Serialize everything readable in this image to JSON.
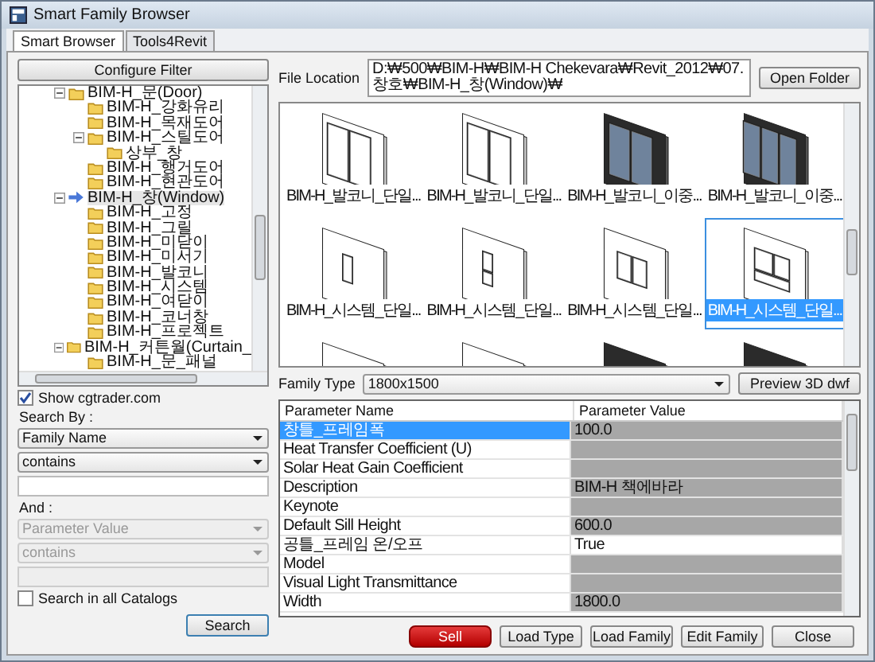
{
  "window": {
    "title": "Smart Family Browser"
  },
  "tabs": [
    {
      "label": "Smart Browser",
      "selected": true
    },
    {
      "label": "Tools4Revit",
      "selected": false
    }
  ],
  "filter": {
    "configure_button": "Configure Filter",
    "tree": [
      {
        "label": "BIM-H_문(Door)",
        "selected": false,
        "expanded": true,
        "children": [
          {
            "label": "BIM-H_강화유리",
            "selected": false
          },
          {
            "label": "BIM-H_목재도어",
            "selected": false
          },
          {
            "label": "BIM-H_스틸도어",
            "selected": false,
            "expanded": true,
            "children": [
              {
                "label": "상부_창",
                "selected": false
              }
            ]
          },
          {
            "label": "BIM-H_행거도어",
            "selected": false
          },
          {
            "label": "BIM-H_현관도어",
            "selected": false
          }
        ]
      },
      {
        "label": "BIM-H_창(Window)",
        "selected": true,
        "expanded": true,
        "children": [
          {
            "label": "BIM-H_고정",
            "selected": false
          },
          {
            "label": "BIM-H_그릴",
            "selected": false
          },
          {
            "label": "BIM-H_미닫이",
            "selected": false
          },
          {
            "label": "BIM-H_미서기",
            "selected": false
          },
          {
            "label": "BIM-H_발코니",
            "selected": false
          },
          {
            "label": "BIM-H_시스템",
            "selected": false
          },
          {
            "label": "BIM-H_여닫이",
            "selected": false
          },
          {
            "label": "BIM-H_코너창",
            "selected": false
          },
          {
            "label": "BIM-H_프로젝트",
            "selected": false
          }
        ]
      },
      {
        "label": "BIM-H_커튼월(Curtain_",
        "selected": false,
        "expanded": true,
        "children": [
          {
            "label": "BIM-H_문_패널",
            "selected": false
          }
        ]
      }
    ],
    "show_cgtrader": {
      "label": "Show cgtrader.com",
      "checked": true
    },
    "search_by_label": "Search By :",
    "search_field": {
      "value": "Family Name"
    },
    "operator": {
      "value": "contains"
    },
    "and_label": "And :",
    "param_field": {
      "value": "Parameter Value",
      "disabled": true
    },
    "param_operator": {
      "value": "contains",
      "disabled": true
    },
    "search_all": {
      "label": "Search in all Catalogs",
      "checked": false
    },
    "search_button": "Search"
  },
  "file_location": {
    "label": "File Location",
    "value": "D:₩500₩BIM-H₩BIM-H Chekevara₩Revit_2012₩07. 창호₩BIM-H_창(Window)₩",
    "button": "Open Folder"
  },
  "thumbnails": [
    {
      "label": "BIM-H_발코니_단일...",
      "kind": "double",
      "selected": false
    },
    {
      "label": "BIM-H_발코니_단일...",
      "kind": "double",
      "selected": false
    },
    {
      "label": "BIM-H_발코니_이중...",
      "kind": "darkdouble",
      "selected": false
    },
    {
      "label": "BIM-H_발코니_이중...",
      "kind": "darktriple",
      "selected": false
    },
    {
      "label": "BIM-H_시스템_단일...",
      "kind": "narrow",
      "selected": false
    },
    {
      "label": "BIM-H_시스템_단일...",
      "kind": "split",
      "selected": false
    },
    {
      "label": "BIM-H_시스템_단일...",
      "kind": "pair",
      "selected": false
    },
    {
      "label": "BIM-H_시스템_단일...",
      "kind": "grid",
      "selected": true
    },
    {
      "kind": "narrow",
      "selected": false
    },
    {
      "kind": "narrow",
      "selected": false
    },
    {
      "kind": "darknarrow",
      "selected": false
    },
    {
      "kind": "darknarrow",
      "selected": false
    }
  ],
  "family_type": {
    "label": "Family Type",
    "value": "1800x1500",
    "button": "Preview 3D dwf"
  },
  "parameters": {
    "columns": [
      "Parameter Name",
      "Parameter Value"
    ],
    "rows": [
      {
        "name": "창틀_프레임폭",
        "value": "100.0",
        "selected": true,
        "editable": false
      },
      {
        "name": "Heat Transfer Coefficient (U)",
        "selected": false,
        "editable": false
      },
      {
        "name": "Solar Heat Gain Coefficient",
        "selected": false,
        "editable": false
      },
      {
        "name": "Description",
        "value": "BIM-H 책에바라",
        "selected": false,
        "editable": false
      },
      {
        "name": "Keynote",
        "selected": false,
        "editable": false
      },
      {
        "name": "Default Sill Height",
        "value": "600.0",
        "selected": false,
        "editable": false
      },
      {
        "name": "공틀_프레임 온/오프",
        "value": "True",
        "selected": false,
        "editable": true
      },
      {
        "name": "Model",
        "selected": false,
        "editable": false
      },
      {
        "name": "Visual Light Transmittance",
        "selected": false,
        "editable": false
      },
      {
        "name": "Width",
        "value": "1800.0",
        "selected": false,
        "editable": false
      }
    ]
  },
  "buttons": [
    {
      "label": "Sell",
      "kind": "primary"
    },
    {
      "label": "Load Type",
      "kind": "normal"
    },
    {
      "label": "Load Family",
      "kind": "normal"
    },
    {
      "label": "Edit Family",
      "kind": "normal"
    },
    {
      "label": "Close",
      "kind": "normal"
    }
  ]
}
